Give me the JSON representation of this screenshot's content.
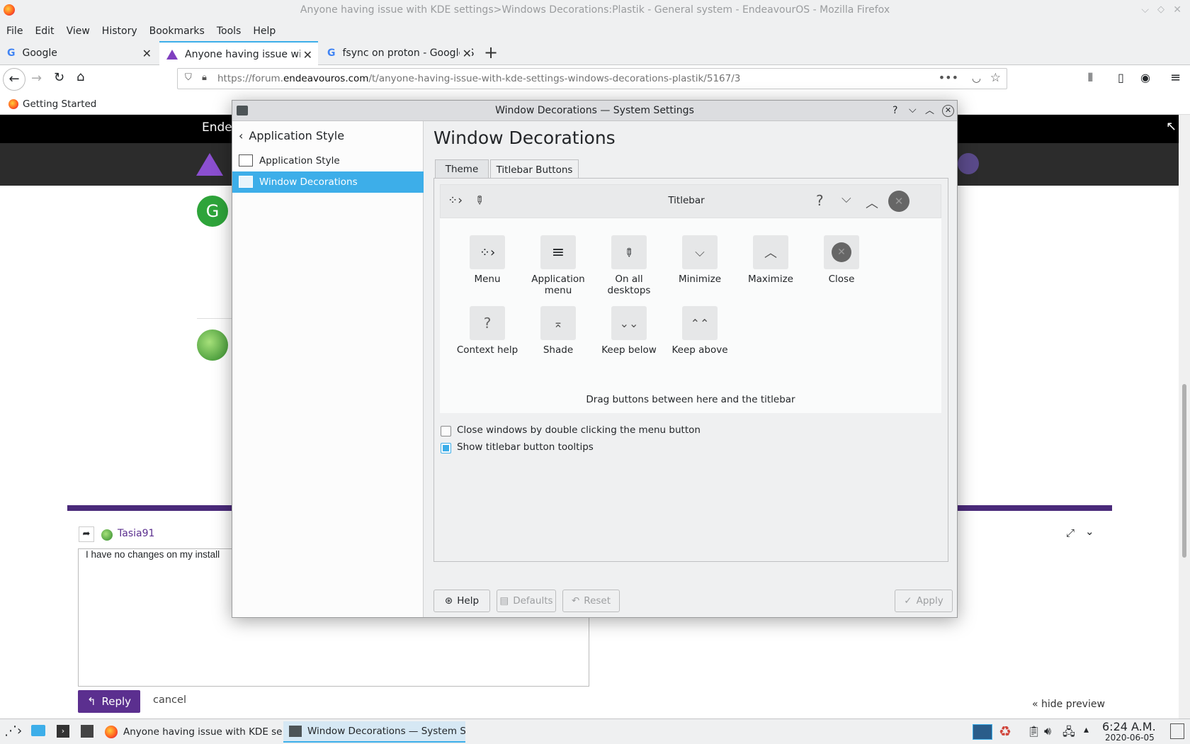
{
  "window_title": "Anyone having issue with KDE settings>Windows Decorations:Plastik - General system - EndeavourOS - Mozilla Firefox",
  "menubar": [
    "File",
    "Edit",
    "View",
    "History",
    "Bookmarks",
    "Tools",
    "Help"
  ],
  "tabs": [
    {
      "label": "Google"
    },
    {
      "label": "Anyone having issue with"
    },
    {
      "label": "fsync on proton - Google S"
    }
  ],
  "url": {
    "prefix": "https://forum.",
    "domain": "endeavouros.com",
    "path": "/t/anyone-having-issue-with-kde-settings-windows-decorations-plastik/5167/3"
  },
  "bookmarks": [
    "Getting Started"
  ],
  "page": {
    "site_text": "Endea",
    "reply_user": "Tasia91",
    "editor_text": "I have no changes on my install",
    "reply_label": "Reply",
    "cancel_label": "cancel",
    "hide_preview": "« hide preview"
  },
  "dialog": {
    "title": "Window Decorations — System Settings",
    "back_label": "Application Style",
    "sidebar": [
      {
        "label": "Application Style",
        "selected": false
      },
      {
        "label": "Window Decorations",
        "selected": true
      }
    ],
    "heading": "Window Decorations",
    "tabs": [
      {
        "label": "Theme"
      },
      {
        "label": "Titlebar Buttons"
      }
    ],
    "titlebar_label": "Titlebar",
    "buttons_row1": [
      {
        "label": "Menu",
        "icon": "menu-icon"
      },
      {
        "label": "Application menu",
        "icon": "hamburger-icon"
      },
      {
        "label": "On all desktops",
        "icon": "pin-icon"
      },
      {
        "label": "Minimize",
        "icon": "chevron-down-icon"
      },
      {
        "label": "Maximize",
        "icon": "chevron-up-icon"
      },
      {
        "label": "Close",
        "icon": "close-icon"
      }
    ],
    "buttons_row2": [
      {
        "label": "Context help",
        "icon": "question-icon"
      },
      {
        "label": "Shade",
        "icon": "shade-icon"
      },
      {
        "label": "Keep below",
        "icon": "double-chevron-down-icon"
      },
      {
        "label": "Keep above",
        "icon": "double-chevron-up-icon"
      }
    ],
    "drag_hint": "Drag buttons between here and the titlebar",
    "checkboxes": [
      {
        "label": "Close windows by double clicking the menu button",
        "checked": false
      },
      {
        "label": "Show titlebar button tooltips",
        "checked": true
      }
    ],
    "footer": {
      "help": "Help",
      "defaults": "Defaults",
      "reset": "Reset",
      "apply": "Apply"
    }
  },
  "taskbar": {
    "tasks": [
      {
        "label": "Anyone having issue with KDE sett..."
      },
      {
        "label": "Window Decorations  — System S..."
      }
    ],
    "time": "6:24 A.M.",
    "date": "2020-06-05"
  },
  "colors": {
    "accent": "#3daee9",
    "purple": "#5b2f8f"
  }
}
